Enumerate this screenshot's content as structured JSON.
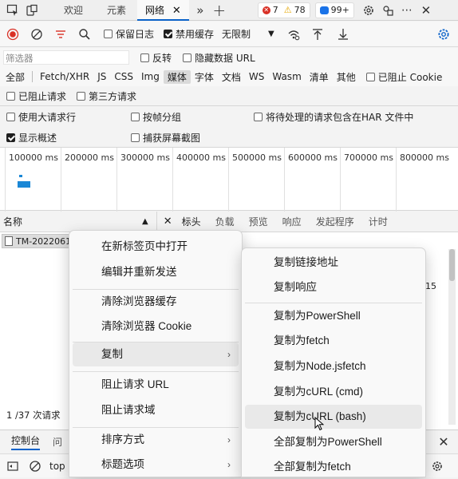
{
  "tabbar": {
    "tabs": [
      {
        "label": "欢迎",
        "active": false
      },
      {
        "label": "元素",
        "active": false
      },
      {
        "label": "网络",
        "active": true
      }
    ],
    "error_count": "7",
    "warning_count": "78",
    "issues_count": "99+"
  },
  "toolbar": {
    "preserve_log": "保留日志",
    "disable_cache": "禁用缓存",
    "throttle_value": "无限制"
  },
  "filter": {
    "placeholder": "筛选器",
    "invert": "反转",
    "hide_data_urls": "隐藏数据 URL"
  },
  "types": [
    "全部",
    "Fetch/XHR",
    "JS",
    "CSS",
    "Img",
    "媒体",
    "字体",
    "文档",
    "WS",
    "Wasm",
    "清单",
    "其他"
  ],
  "types_selected": "媒体",
  "blocked_cookie": "已阻止 Cookie",
  "blocked_requests": "已阻止请求",
  "third_party": "第三方请求",
  "settings": {
    "large_rows": "使用大请求行",
    "group_by_frame": "按帧分组",
    "har_pending": "将待处理的请求包含在HAR 文件中",
    "show_overview": "显示概述",
    "capture_screenshots": "捕获屏幕截图"
  },
  "overview_ticks": [
    "100000 ms",
    "200000 ms",
    "300000 ms",
    "400000 ms",
    "500000 ms",
    "600000 ms",
    "700000 ms",
    "800000 ms"
  ],
  "columns": {
    "name_header": "名称",
    "detail_tabs": [
      "标头",
      "负载",
      "预览",
      "响应",
      "发起程序",
      "计时"
    ]
  },
  "request_row": {
    "name": "TM-2022061",
    "right_fragment": "15"
  },
  "status": {
    "requests": "1 /37 次请求"
  },
  "drawer": {
    "tab_console": "控制台",
    "tab_issues": "问",
    "context": "top"
  },
  "context_menu": {
    "open_new_tab": "在新标签页中打开",
    "edit_resend": "编辑并重新发送",
    "clear_cache": "清除浏览器缓存",
    "clear_cookies": "清除浏览器 Cookie",
    "copy": "复制",
    "block_url": "阻止请求 URL",
    "block_domain": "阻止请求域",
    "sort_by": "排序方式",
    "header_options": "标题选项"
  },
  "copy_submenu": {
    "copy_link": "复制链接地址",
    "copy_response": "复制响应",
    "copy_powershell": "复制为PowerShell",
    "copy_fetch": "复制为fetch",
    "copy_node_fetch": "复制为Node.jsfetch",
    "copy_curl_cmd": "复制为cURL (cmd)",
    "copy_curl_bash": "复制为cURL (bash)",
    "copy_all_powershell": "全部复制为PowerShell",
    "copy_all_fetch": "全部复制为fetch"
  },
  "colors": {
    "accent": "#0a62c9",
    "record": "#d93025",
    "error_badge": "#d93025",
    "warning_badge": "#e6a700",
    "issues_badge": "#1a73e8",
    "overview_bar": "#1a87d6"
  }
}
